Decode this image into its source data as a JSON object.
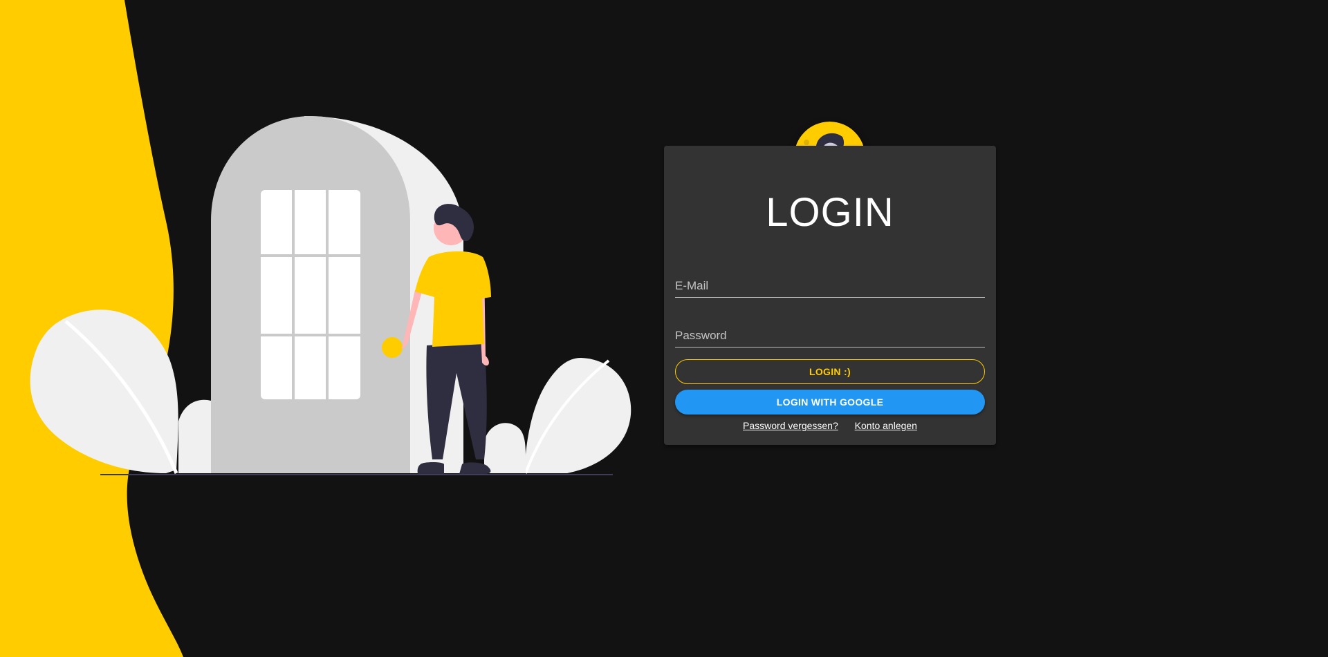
{
  "colors": {
    "background": "#121212",
    "accent_yellow": "#ffcc00",
    "card": "#333333",
    "google_blue": "#2196f3"
  },
  "illustration": {
    "name": "person-at-door-illustration"
  },
  "login_card": {
    "avatar_icon": "user-avatar-icon",
    "title": "LOGIN",
    "email_placeholder": "E-Mail",
    "email_value": "",
    "password_placeholder": "Password",
    "password_value": "",
    "login_button_label": "LOGIN :)",
    "google_button_label": "LOGIN WITH GOOGLE",
    "forgot_password_link": "Password vergessen?",
    "create_account_link": "Konto anlegen"
  }
}
